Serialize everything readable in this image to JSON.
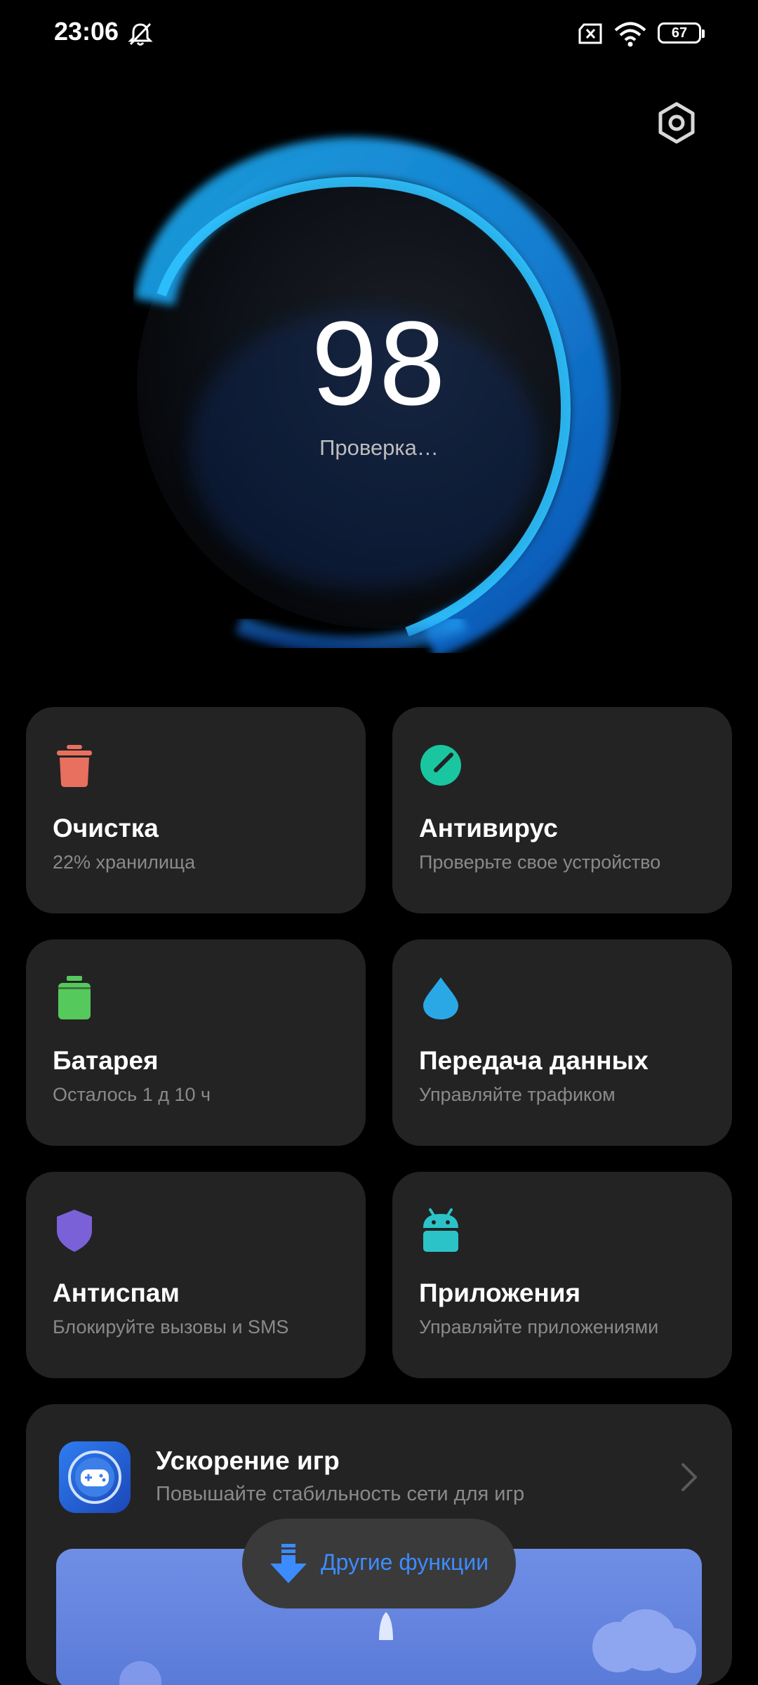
{
  "status_bar": {
    "time": "23:06",
    "battery": "67"
  },
  "hero": {
    "score": "98",
    "status": "Проверка…"
  },
  "tiles": [
    {
      "title": "Очистка",
      "subtitle": "22% хранилища",
      "icon": "trash-icon",
      "color": "#e8705e"
    },
    {
      "title": "Антивирус",
      "subtitle": "Проверьте свое устройство",
      "icon": "antivirus-icon",
      "color": "#19c6a0"
    },
    {
      "title": "Батарея",
      "subtitle": "Осталось 1 д 10 ч",
      "icon": "battery-icon",
      "color": "#56c95c"
    },
    {
      "title": "Передача данных",
      "subtitle": "Управляйте трафиком",
      "icon": "drop-icon",
      "color": "#2aa8e6"
    },
    {
      "title": "Антиспам",
      "subtitle": "Блокируйте вызовы и SMS",
      "icon": "shield-icon",
      "color": "#7b61d8"
    },
    {
      "title": "Приложения",
      "subtitle": "Управляйте приложениями",
      "icon": "android-icon",
      "color": "#2cc3c8"
    }
  ],
  "game_boost": {
    "title": "Ускорение игр",
    "subtitle": "Повышайте стабильность сети для игр",
    "icon": "gamepad-icon"
  },
  "more_button": {
    "label": "Другие функции",
    "accent": "#3d8cff"
  }
}
